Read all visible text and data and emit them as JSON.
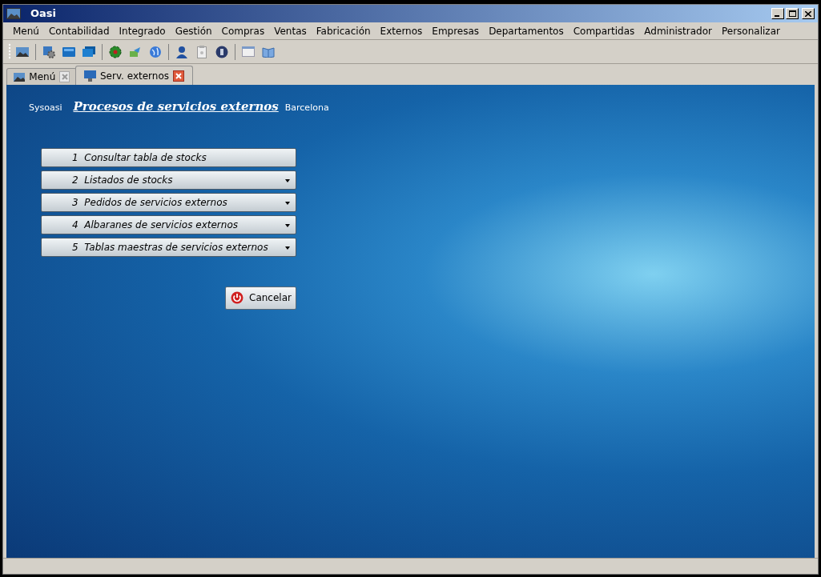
{
  "window": {
    "title": "Oasi"
  },
  "menu": [
    "Menú",
    "Contabilidad",
    "Integrado",
    "Gestión",
    "Compras",
    "Ventas",
    "Fabricación",
    "Externos",
    "Empresas",
    "Departamentos",
    "Compartidas",
    "Administrador",
    "Personalizar"
  ],
  "tabs": [
    {
      "label": "Menú",
      "selected": false
    },
    {
      "label": "Serv. externos",
      "selected": true
    }
  ],
  "header": {
    "user": "Sysoasi",
    "title": "Procesos de servicios externos",
    "location": "Barcelona"
  },
  "options": [
    {
      "label": "1  Consultar tabla de stocks",
      "submenu": false
    },
    {
      "label": "2  Listados de stocks",
      "submenu": true
    },
    {
      "label": "3  Pedidos de servicios externos",
      "submenu": true
    },
    {
      "label": "4  Albaranes de servicios externos",
      "submenu": true
    },
    {
      "label": "5  Tablas maestras de servicios externos",
      "submenu": true
    }
  ],
  "cancel_button": "Cancelar"
}
